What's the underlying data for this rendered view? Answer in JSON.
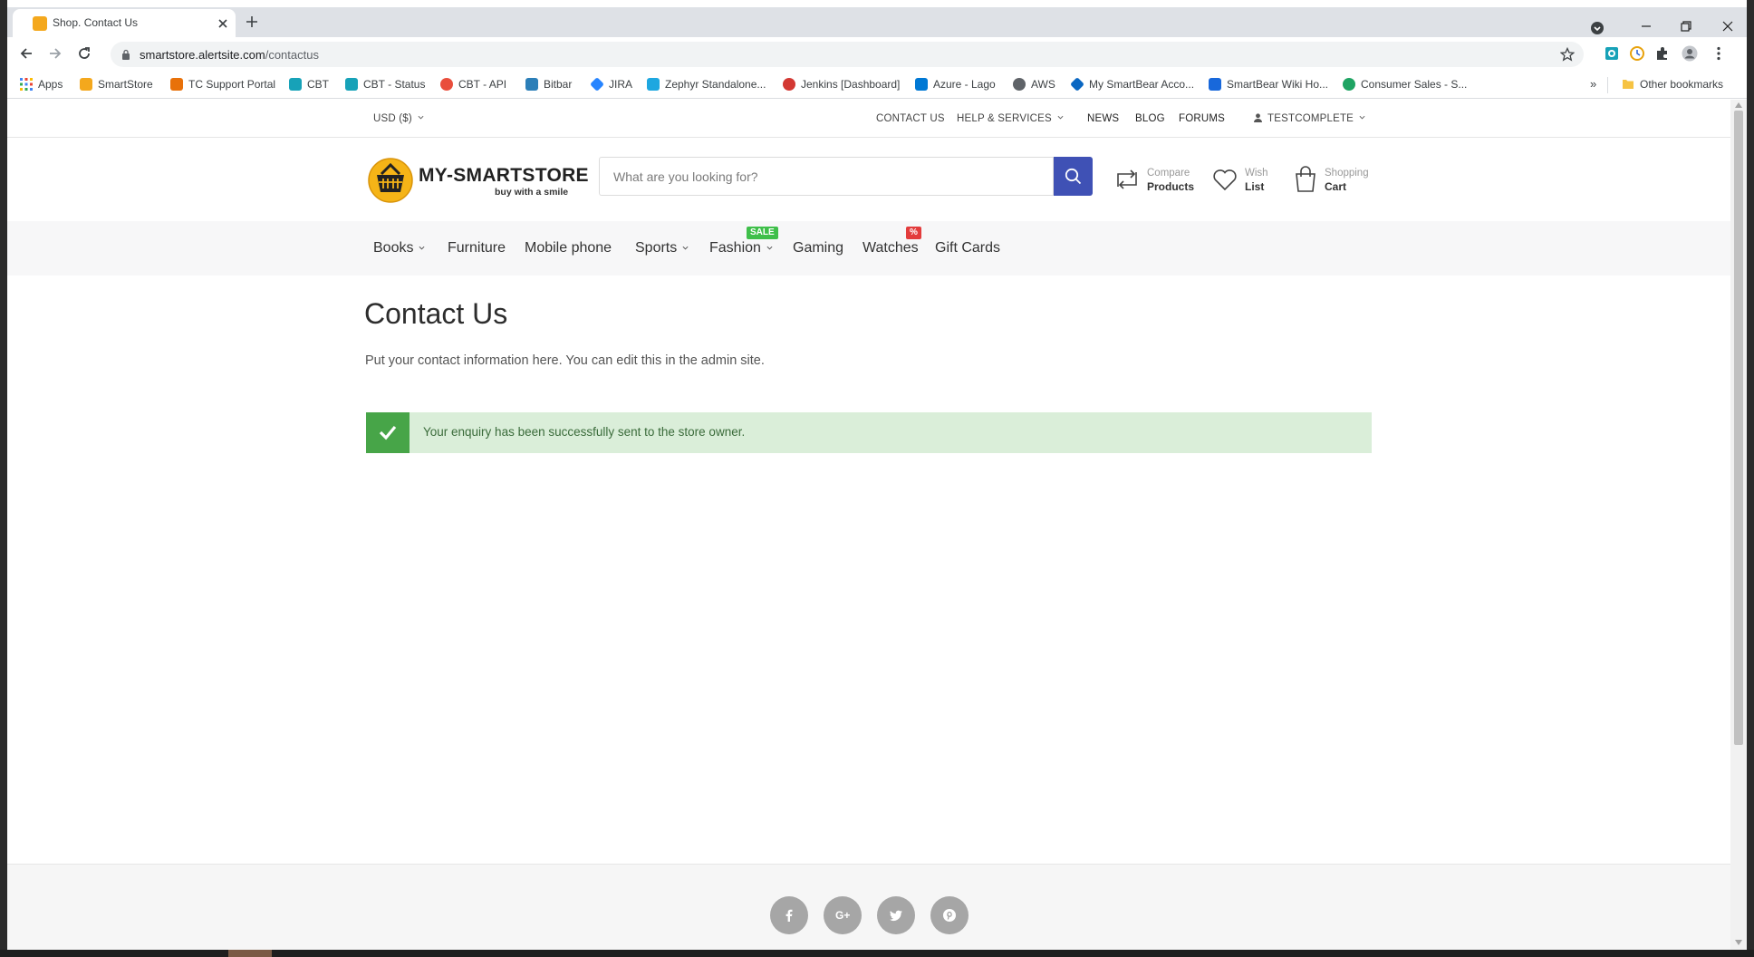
{
  "browser": {
    "tab_title": "Shop. Contact Us",
    "url_host": "smartstore.alertsite.com",
    "url_path": "/contactus",
    "bookmarks": [
      {
        "label": "Apps",
        "icon": "apps-grid-icon",
        "color": "#4285f4"
      },
      {
        "label": "SmartStore",
        "icon": "smartstore-icon",
        "color": "#f4a81d"
      },
      {
        "label": "TC Support Portal",
        "icon": "tc-support-icon",
        "color": "#e8710a"
      },
      {
        "label": "CBT",
        "icon": "cbt-icon",
        "color": "#17a2b8"
      },
      {
        "label": "CBT - Status",
        "icon": "cbt-status-icon",
        "color": "#17a2b8"
      },
      {
        "label": "CBT - API",
        "icon": "cbt-api-icon",
        "color": "#e94e3c"
      },
      {
        "label": "Bitbar",
        "icon": "bitbar-icon",
        "color": "#2c7fb8"
      },
      {
        "label": "JIRA",
        "icon": "jira-icon",
        "color": "#2684ff"
      },
      {
        "label": "Zephyr Standalone...",
        "icon": "zephyr-icon",
        "color": "#1ea7e0"
      },
      {
        "label": "Jenkins [Dashboard]",
        "icon": "jenkins-icon",
        "color": "#d33833"
      },
      {
        "label": "Azure - Lago",
        "icon": "azure-icon",
        "color": "#0078d4"
      },
      {
        "label": "AWS",
        "icon": "globe-icon",
        "color": "#5f6368"
      },
      {
        "label": "My SmartBear Acco...",
        "icon": "smartbear-icon",
        "color": "#0a67c2"
      },
      {
        "label": "SmartBear Wiki Ho...",
        "icon": "confluence-icon",
        "color": "#1868db"
      },
      {
        "label": "Consumer Sales - S...",
        "icon": "consumer-sales-icon",
        "color": "#1fa463"
      }
    ],
    "bookmarks_more": "»",
    "other_bookmarks": "Other bookmarks"
  },
  "topbar": {
    "currency": "USD ($)",
    "contact": "CONTACT US",
    "help": "HELP & SERVICES",
    "news": "NEWS",
    "blog": "BLOG",
    "forums": "FORUMS",
    "account": "TESTCOMPLETE"
  },
  "header": {
    "logo_text": "MY-SMARTSTORE",
    "logo_sub": "buy with a smile",
    "search_placeholder": "What are you looking for?",
    "compare_l1": "Compare",
    "compare_l2": "Products",
    "wish_l1": "Wish",
    "wish_l2": "List",
    "cart_l1": "Shopping",
    "cart_l2": "Cart"
  },
  "menu": {
    "books": "Books",
    "furniture": "Furniture",
    "mobile": "Mobile phone",
    "sports": "Sports",
    "fashion": "Fashion",
    "fashion_badge": "SALE",
    "gaming": "Gaming",
    "watches": "Watches",
    "watches_badge": "%",
    "giftcards": "Gift Cards",
    "colors": {
      "sale_badge": "#3fbf4a",
      "percent_badge": "#e33c3c",
      "search_button": "#3f51b5"
    }
  },
  "content": {
    "title": "Contact Us",
    "text": "Put your contact information here. You can edit this in the admin site.",
    "alert": "Your enquiry has been successfully sent to the store owner.",
    "alert_color": "#47a548"
  },
  "footer": {
    "social": [
      "facebook-icon",
      "google-plus-icon",
      "twitter-icon",
      "pinterest-icon"
    ]
  }
}
